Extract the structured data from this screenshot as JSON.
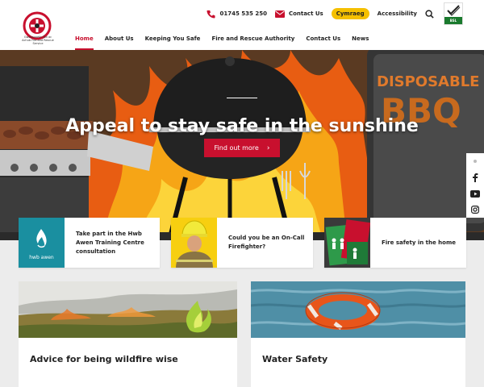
{
  "header": {
    "logo_text": "Gwasanaeth Tân ac Achub Fire and Rescue Service",
    "phone": "01745 535 250",
    "contact": "Contact Us",
    "language": "Cymraeg",
    "accessibility": "Accessibility",
    "bsl_label": "BSL"
  },
  "nav": {
    "items": [
      "Home",
      "About Us",
      "Keeping You Safe",
      "Fire and Rescue Authority",
      "Contact Us",
      "News"
    ],
    "active": "Home"
  },
  "hero": {
    "title": "Appeal to stay safe in the sunshine",
    "button": "Find out more",
    "sign_line1": "DISPOSABLE",
    "sign_line2": "BBQ"
  },
  "cards": [
    {
      "text": "Take part in the Hwb Awen Training Centre consultation",
      "img_label": "hwb awen"
    },
    {
      "text": "Could you be an On-Call Firefighter?"
    },
    {
      "text": "Fire safety in the home"
    }
  ],
  "tiles": [
    {
      "title": "Advice for being wildfire wise"
    },
    {
      "title": "Water Safety"
    }
  ],
  "colors": {
    "brand_red": "#c8102e",
    "cymraeg_yellow": "#f5c000",
    "hwb_teal": "#1a8fa0"
  }
}
